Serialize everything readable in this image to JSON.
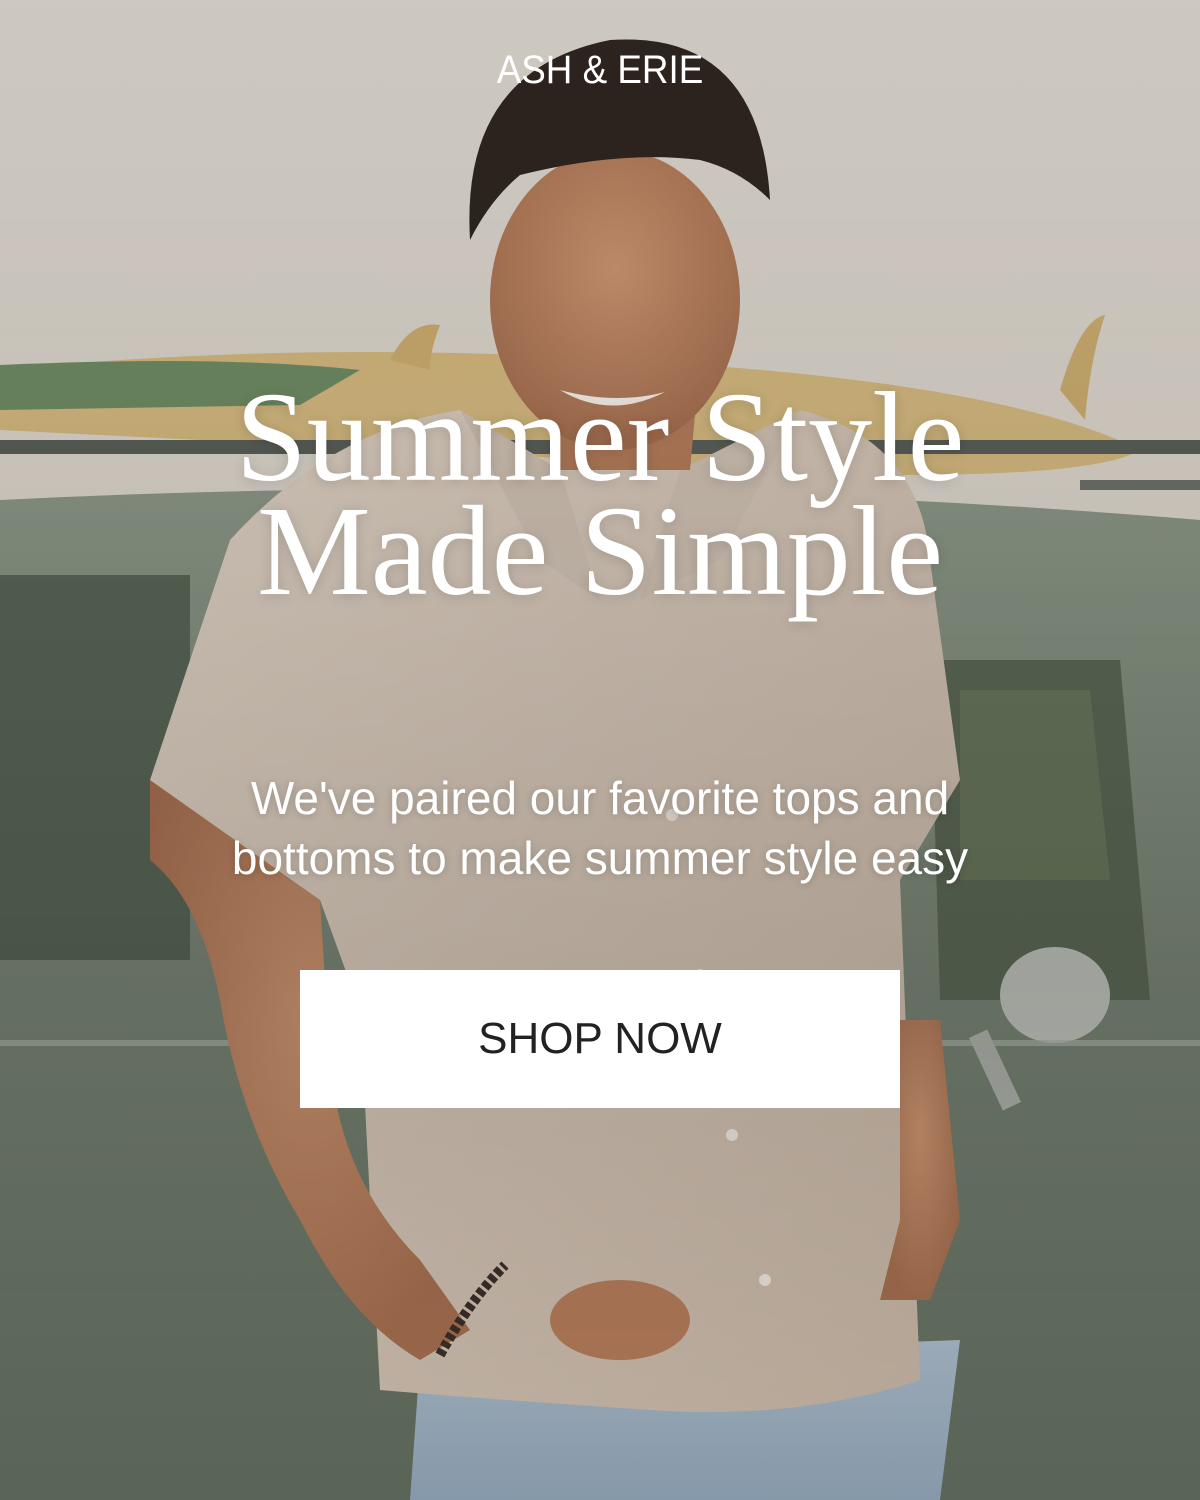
{
  "brand": {
    "name": "ASH & ERIE"
  },
  "hero": {
    "headline_line1": "Summer Style",
    "headline_line2": "Made Simple",
    "subhead_line1": "We've paired our favorite tops and",
    "subhead_line2": "bottoms to make summer style easy",
    "image": "smiling man in short-sleeve camp shirt leaning on vintage car with surfboards"
  },
  "cta": {
    "label": "SHOP NOW"
  },
  "colors": {
    "text": "#ffffff",
    "button_bg": "#ffffff",
    "button_text": "#222222",
    "sky": "#d8d2c8",
    "car": "#7f8a7d",
    "shirt": "#d4c4b5"
  }
}
